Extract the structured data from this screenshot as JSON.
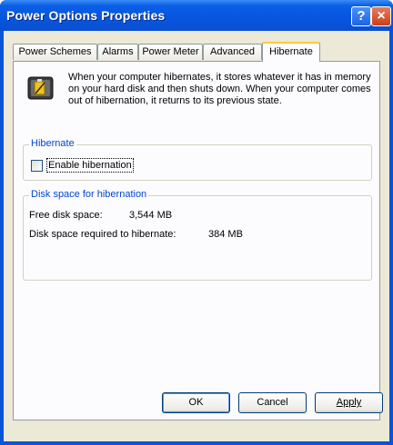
{
  "window": {
    "title": "Power Options Properties"
  },
  "title_buttons": {
    "help": "?",
    "close": "×"
  },
  "tabs": [
    {
      "label": "Power Schemes"
    },
    {
      "label": "Alarms"
    },
    {
      "label": "Power Meter"
    },
    {
      "label": "Advanced"
    },
    {
      "label": "Hibernate"
    }
  ],
  "description": "When your computer hibernates, it stores whatever it has in memory on your hard disk and then shuts down. When your computer comes out of hibernation, it returns to its previous state.",
  "hibernate_group": {
    "legend": "Hibernate",
    "checkbox_label": "Enable hibernation",
    "checked": false
  },
  "disk_group": {
    "legend": "Disk space for hibernation",
    "free_label": "Free disk space:",
    "free_value": "3,544 MB",
    "required_label": "Disk space required to hibernate:",
    "required_value": "384 MB"
  },
  "buttons": {
    "ok": "OK",
    "cancel": "Cancel",
    "apply": "Apply"
  }
}
